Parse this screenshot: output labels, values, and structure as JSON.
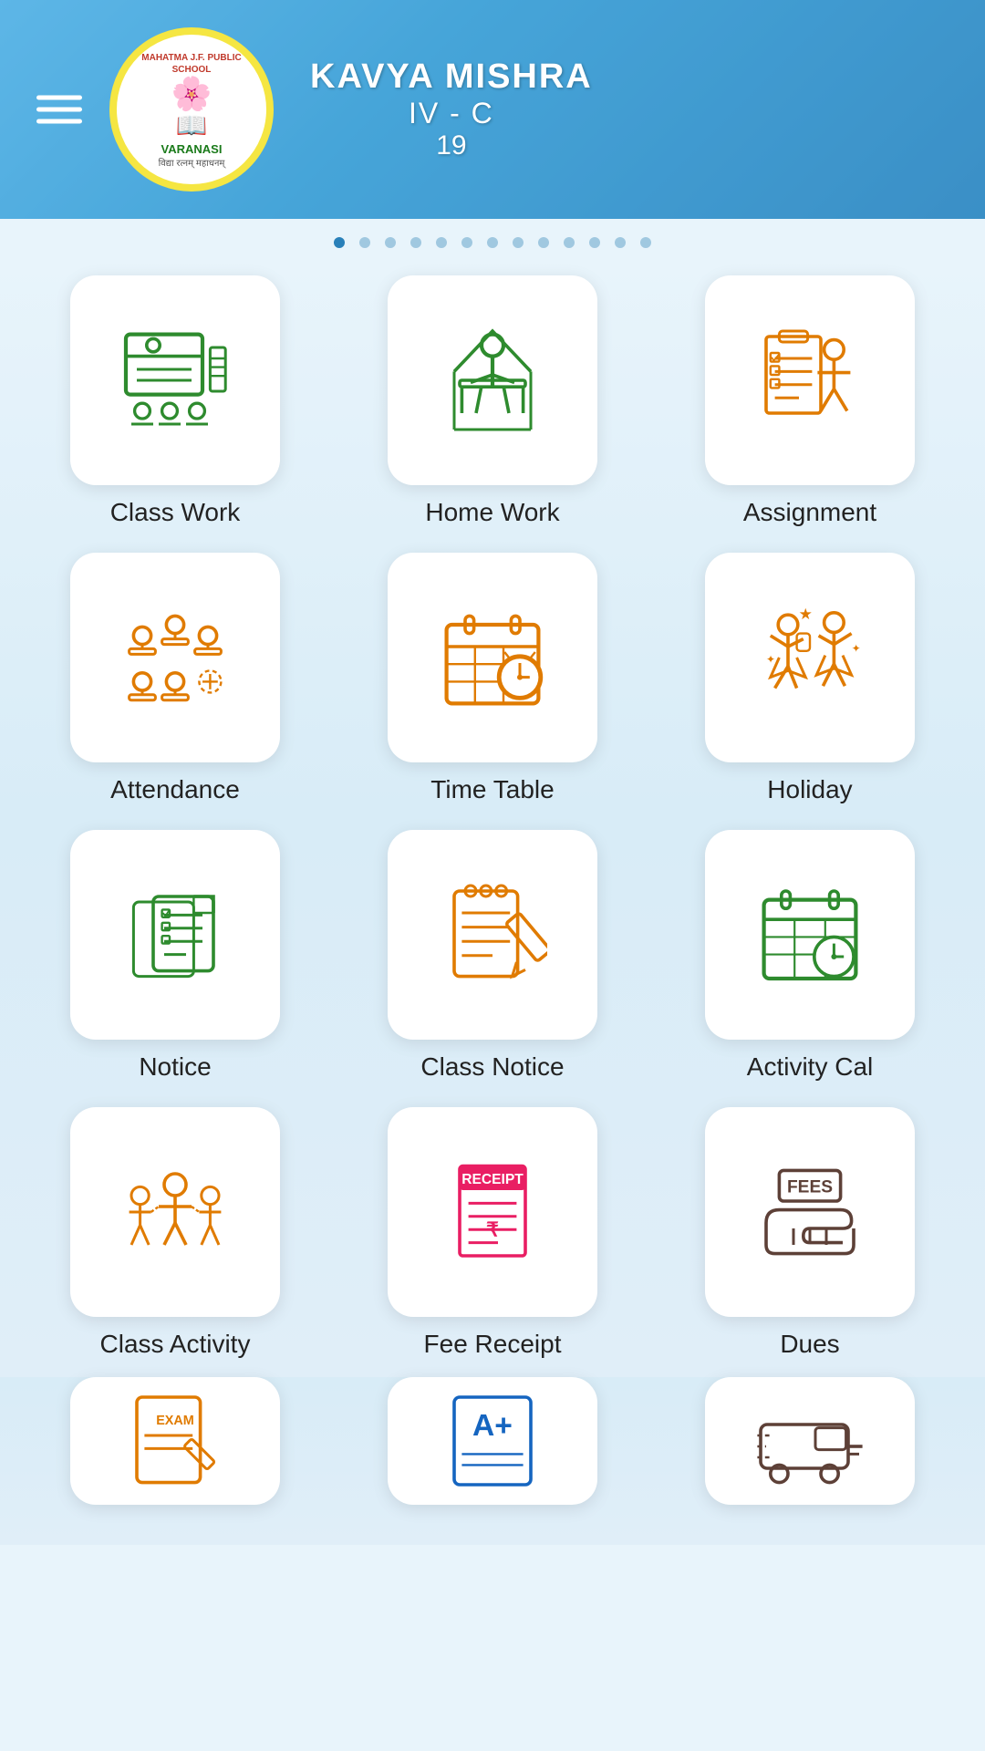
{
  "header": {
    "student_name": "KAVYA MISHRA",
    "student_class": "IV - C",
    "student_roll": "19",
    "school_name": "MAHATMA J.F. PUBLIC SCHOOL",
    "school_location": "VARANASI",
    "school_tagline": "विद्या रत्नम् महाधनम्",
    "menu_icon": "hamburger-icon"
  },
  "dots": {
    "total": 13,
    "active": 0
  },
  "grid": {
    "items": [
      {
        "id": "class-work",
        "label": "Class Work",
        "color": "#2e8b2e",
        "type": "classwork"
      },
      {
        "id": "home-work",
        "label": "Home Work",
        "color": "#2e8b2e",
        "type": "homework"
      },
      {
        "id": "assignment",
        "label": "Assignment",
        "color": "#e07b00",
        "type": "assignment"
      },
      {
        "id": "attendance",
        "label": "Attendance",
        "color": "#e07b00",
        "type": "attendance"
      },
      {
        "id": "time-table",
        "label": "Time Table",
        "color": "#e07b00",
        "type": "timetable"
      },
      {
        "id": "holiday",
        "label": "Holiday",
        "color": "#e07b00",
        "type": "holiday"
      },
      {
        "id": "notice",
        "label": "Notice",
        "color": "#2e8b2e",
        "type": "notice"
      },
      {
        "id": "class-notice",
        "label": "Class Notice",
        "color": "#e07b00",
        "type": "classnotice"
      },
      {
        "id": "activity-cal",
        "label": "Activity Cal",
        "color": "#2e8b2e",
        "type": "activitycal"
      },
      {
        "id": "class-activity",
        "label": "Class Activity",
        "color": "#e07b00",
        "type": "classactivity"
      },
      {
        "id": "fee-receipt",
        "label": "Fee Receipt",
        "color": "#e91e63",
        "type": "feereceipt"
      },
      {
        "id": "dues",
        "label": "Dues",
        "color": "#5d4037",
        "type": "dues"
      }
    ],
    "partial_items": [
      {
        "id": "exam",
        "label": "",
        "color": "#e07b00",
        "type": "exam"
      },
      {
        "id": "result",
        "label": "",
        "color": "#1565c0",
        "type": "result"
      },
      {
        "id": "transport",
        "label": "",
        "color": "#5d4037",
        "type": "transport"
      }
    ]
  }
}
